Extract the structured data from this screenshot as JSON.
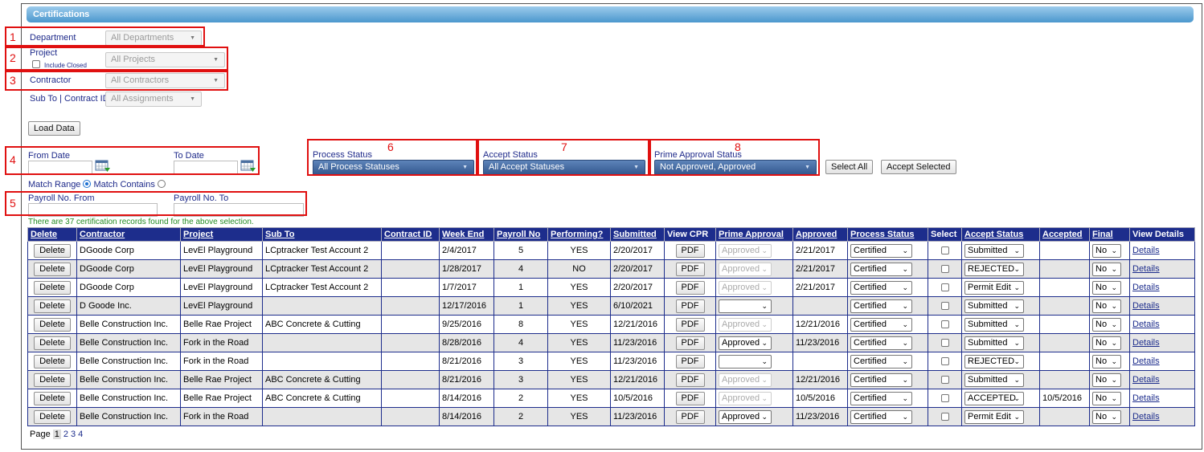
{
  "header": {
    "title": "Certifications"
  },
  "filters": {
    "department_label": "Department",
    "department_value": "All Departments",
    "project_label": "Project",
    "include_closed_label": "Include Closed",
    "project_value": "All Projects",
    "contractor_label": "Contractor",
    "contractor_value": "All Contractors",
    "subto_label": "Sub To | Contract ID",
    "subto_value": "All Assignments",
    "load_button": "Load Data",
    "from_date_label": "From Date",
    "to_date_label": "To Date",
    "match_range_label": "Match Range",
    "match_contains_label": "Match Contains",
    "payroll_from_label": "Payroll No. From",
    "payroll_to_label": "Payroll No. To",
    "process_status_label": "Process Status",
    "process_status_value": "All Process Statuses",
    "accept_status_label": "Accept Status",
    "accept_status_value": "All Accept Statuses",
    "prime_approval_label": "Prime Approval Status",
    "prime_approval_value": "Not Approved, Approved",
    "select_all_button": "Select All",
    "accept_selected_button": "Accept Selected"
  },
  "annotations": [
    "1",
    "2",
    "3",
    "4",
    "5",
    "6",
    "7",
    "8"
  ],
  "info_text": "There are 37 certification records found for the above selection.",
  "table": {
    "headers": [
      "Delete",
      "Contractor",
      "Project",
      "Sub To",
      "Contract ID",
      "Week End",
      "Payroll No",
      "Performing?",
      "Submitted",
      "View CPR",
      "Prime Approval",
      "Approved",
      "Process Status",
      "Select",
      "Accept Status",
      "Accepted",
      "Final",
      "View Details"
    ],
    "delete_label": "Delete",
    "pdf_label": "PDF",
    "details_label": "Details",
    "rows": [
      {
        "contractor": "DGoode Corp",
        "project": "LevEl Playground",
        "subto": "LCptracker Test Account 2",
        "contract_id": "",
        "week_end": "2/4/2017",
        "payroll": "5",
        "performing": "YES",
        "submitted": "2/20/2017",
        "prime": "Approved",
        "prime_disabled": true,
        "approved": "2/21/2017",
        "process": "Certified",
        "accept": "Submitted",
        "accepted": "",
        "final": "No"
      },
      {
        "contractor": "DGoode Corp",
        "project": "LevEl Playground",
        "subto": "LCptracker Test Account 2",
        "contract_id": "",
        "week_end": "1/28/2017",
        "payroll": "4",
        "performing": "NO",
        "submitted": "2/20/2017",
        "prime": "Approved",
        "prime_disabled": true,
        "approved": "2/21/2017",
        "process": "Certified",
        "accept": "REJECTED",
        "accepted": "",
        "final": "No"
      },
      {
        "contractor": "DGoode Corp",
        "project": "LevEl Playground",
        "subto": "LCptracker Test Account 2",
        "contract_id": "",
        "week_end": "1/7/2017",
        "payroll": "1",
        "performing": "YES",
        "submitted": "2/20/2017",
        "prime": "Approved",
        "prime_disabled": true,
        "approved": "2/21/2017",
        "process": "Certified",
        "accept": "Permit Edit",
        "accepted": "",
        "final": "No"
      },
      {
        "contractor": "D Goode Inc.",
        "project": "LevEl Playground",
        "subto": "",
        "contract_id": "",
        "week_end": "12/17/2016",
        "payroll": "1",
        "performing": "YES",
        "submitted": "6/10/2021",
        "prime": "",
        "prime_disabled": false,
        "approved": "",
        "process": "Certified",
        "accept": "Submitted",
        "accepted": "",
        "final": "No"
      },
      {
        "contractor": "Belle Construction Inc.",
        "project": "Belle Rae Project",
        "subto": "ABC Concrete & Cutting",
        "contract_id": "",
        "week_end": "9/25/2016",
        "payroll": "8",
        "performing": "YES",
        "submitted": "12/21/2016",
        "prime": "Approved",
        "prime_disabled": true,
        "approved": "12/21/2016",
        "process": "Certified",
        "accept": "Submitted",
        "accepted": "",
        "final": "No"
      },
      {
        "contractor": "Belle Construction Inc.",
        "project": "Fork in the Road",
        "subto": "",
        "contract_id": "",
        "week_end": "8/28/2016",
        "payroll": "4",
        "performing": "YES",
        "submitted": "11/23/2016",
        "prime": "Approved",
        "prime_disabled": false,
        "approved": "11/23/2016",
        "process": "Certified",
        "accept": "Submitted",
        "accepted": "",
        "final": "No"
      },
      {
        "contractor": "Belle Construction Inc.",
        "project": "Fork in the Road",
        "subto": "",
        "contract_id": "",
        "week_end": "8/21/2016",
        "payroll": "3",
        "performing": "YES",
        "submitted": "11/23/2016",
        "prime": "",
        "prime_disabled": false,
        "approved": "",
        "process": "Certified",
        "accept": "REJECTED",
        "accepted": "",
        "final": "No"
      },
      {
        "contractor": "Belle Construction Inc.",
        "project": "Belle Rae Project",
        "subto": "ABC Concrete & Cutting",
        "contract_id": "",
        "week_end": "8/21/2016",
        "payroll": "3",
        "performing": "YES",
        "submitted": "12/21/2016",
        "prime": "Approved",
        "prime_disabled": true,
        "approved": "12/21/2016",
        "process": "Certified",
        "accept": "Submitted",
        "accepted": "",
        "final": "No"
      },
      {
        "contractor": "Belle Construction Inc.",
        "project": "Belle Rae Project",
        "subto": "ABC Concrete & Cutting",
        "contract_id": "",
        "week_end": "8/14/2016",
        "payroll": "2",
        "performing": "YES",
        "submitted": "10/5/2016",
        "prime": "Approved",
        "prime_disabled": true,
        "approved": "10/5/2016",
        "process": "Certified",
        "accept": "ACCEPTED",
        "accepted": "10/5/2016",
        "final": "No"
      },
      {
        "contractor": "Belle Construction Inc.",
        "project": "Fork in the Road",
        "subto": "",
        "contract_id": "",
        "week_end": "8/14/2016",
        "payroll": "2",
        "performing": "YES",
        "submitted": "11/23/2016",
        "prime": "Approved",
        "prime_disabled": false,
        "approved": "11/23/2016",
        "process": "Certified",
        "accept": "Permit Edit",
        "accepted": "",
        "final": "No"
      }
    ]
  },
  "pager": {
    "label": "Page",
    "current": "1",
    "pages": [
      "2",
      "3",
      "4"
    ]
  }
}
